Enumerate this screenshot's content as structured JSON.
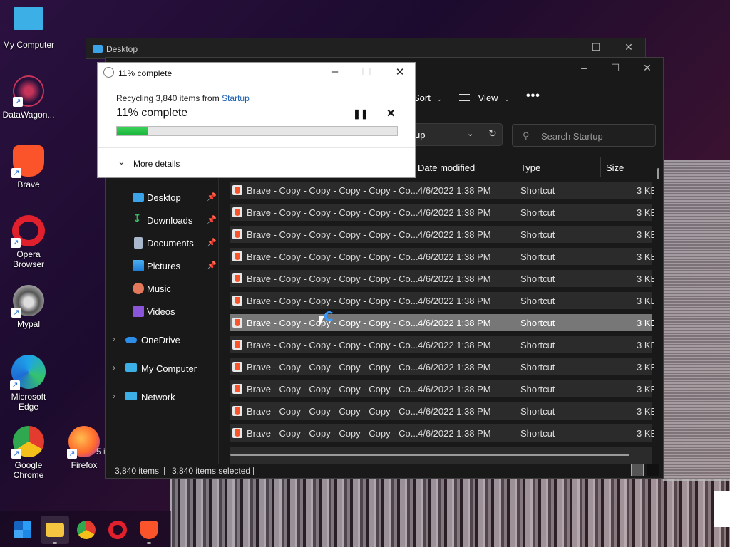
{
  "desktop": {
    "icons": [
      {
        "label": "My Computer"
      },
      {
        "label": "DataWagon..."
      },
      {
        "label": "Brave"
      },
      {
        "label": "Opera Browser"
      },
      {
        "label": "Mypal"
      },
      {
        "label": "Microsoft Edge"
      },
      {
        "label": "Google Chrome"
      },
      {
        "label": "Firefox"
      }
    ],
    "partial_text": "5 i"
  },
  "back_window": {
    "title": "Desktop"
  },
  "explorer": {
    "toolbar": {
      "sort": "Sort",
      "view": "View",
      "more": "•••"
    },
    "address": {
      "text": "up"
    },
    "search": {
      "placeholder": "Search Startup"
    },
    "nav": [
      {
        "label": "Desktop",
        "pinned": true
      },
      {
        "label": "Downloads",
        "pinned": true
      },
      {
        "label": "Documents",
        "pinned": true
      },
      {
        "label": "Pictures",
        "pinned": true
      },
      {
        "label": "Music",
        "pinned": false
      },
      {
        "label": "Videos",
        "pinned": false
      },
      {
        "label": "OneDrive",
        "expandable": true
      },
      {
        "label": "My Computer",
        "expandable": true
      },
      {
        "label": "Network",
        "expandable": true
      }
    ],
    "columns": {
      "date": "Date modified",
      "type": "Type",
      "size": "Size"
    },
    "rows": [
      {
        "name": "Brave - Copy - Copy - Copy - Copy - Co...",
        "date": "4/6/2022 1:38 PM",
        "type": "Shortcut",
        "size": "3 KB"
      },
      {
        "name": "Brave - Copy - Copy - Copy - Copy - Co...",
        "date": "4/6/2022 1:38 PM",
        "type": "Shortcut",
        "size": "3 KB"
      },
      {
        "name": "Brave - Copy - Copy - Copy - Copy - Co...",
        "date": "4/6/2022 1:38 PM",
        "type": "Shortcut",
        "size": "3 KB"
      },
      {
        "name": "Brave - Copy - Copy - Copy - Copy - Co...",
        "date": "4/6/2022 1:38 PM",
        "type": "Shortcut",
        "size": "3 KB"
      },
      {
        "name": "Brave - Copy - Copy - Copy - Copy - Co...",
        "date": "4/6/2022 1:38 PM",
        "type": "Shortcut",
        "size": "3 KB"
      },
      {
        "name": "Brave - Copy - Copy - Copy - Copy - Co...",
        "date": "4/6/2022 1:38 PM",
        "type": "Shortcut",
        "size": "3 KB"
      },
      {
        "name": "Brave - Copy - Copy - Copy - Copy - Co...",
        "date": "4/6/2022 1:38 PM",
        "type": "Shortcut",
        "size": "3 KB"
      },
      {
        "name": "Brave - Copy - Copy - Copy - Copy - Co...",
        "date": "4/6/2022 1:38 PM",
        "type": "Shortcut",
        "size": "3 KB"
      },
      {
        "name": "Brave - Copy - Copy - Copy - Copy - Co...",
        "date": "4/6/2022 1:38 PM",
        "type": "Shortcut",
        "size": "3 KB"
      },
      {
        "name": "Brave - Copy - Copy - Copy - Copy - Co...",
        "date": "4/6/2022 1:38 PM",
        "type": "Shortcut",
        "size": "3 KB"
      },
      {
        "name": "Brave - Copy - Copy - Copy - Copy - Co...",
        "date": "4/6/2022 1:38 PM",
        "type": "Shortcut",
        "size": "3 KB"
      },
      {
        "name": "Brave - Copy - Copy - Copy - Copy - Co...",
        "date": "4/6/2022 1:38 PM",
        "type": "Shortcut",
        "size": "3 KB"
      }
    ],
    "selected_row": 6,
    "status": {
      "items": "3,840 items",
      "selected": "3,840 items selected"
    }
  },
  "dialog": {
    "title": "11% complete",
    "line_prefix": "Recycling 3,840 items from ",
    "line_link": "Startup",
    "progress_text": "11% complete",
    "progress": 0.11,
    "pause": "❚❚",
    "stop": "✕",
    "more_details": "More details"
  },
  "colors": {
    "accent": "#1a5fb4",
    "progress": "#18b33a",
    "brave": "#fb542b"
  }
}
